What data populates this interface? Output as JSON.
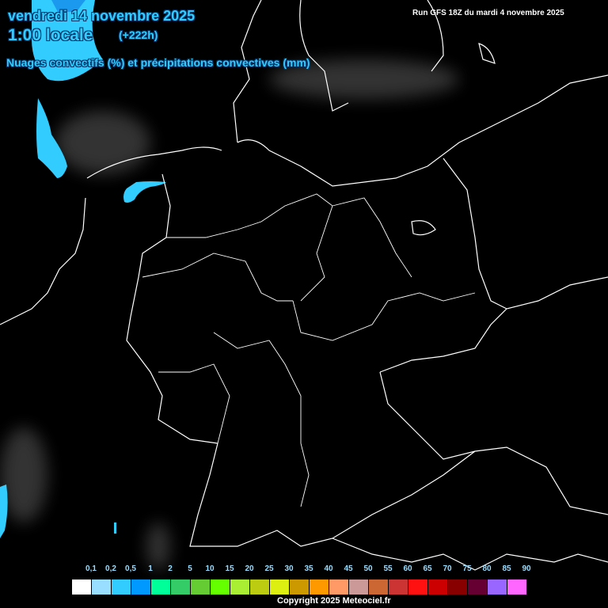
{
  "header": {
    "date": "vendredi 14 novembre 2025",
    "time": "1:00 locale",
    "offset": "(+222h)",
    "subtitle": "Nuages convectifs (%) et précipitations convectives (mm)",
    "run": "Run GFS 18Z du mardi 4 novembre 2025"
  },
  "legend": {
    "labels": [
      "0,1",
      "0,2",
      "0,5",
      "1",
      "2",
      "5",
      "10",
      "15",
      "20",
      "25",
      "30",
      "35",
      "40",
      "45",
      "50",
      "55",
      "60",
      "65",
      "70",
      "75",
      "80",
      "85",
      "90"
    ],
    "colors": [
      "#ffffff",
      "#99ddff",
      "#33ccff",
      "#0099ff",
      "#00ff99",
      "#33cc66",
      "#66cc33",
      "#66ff00",
      "#aaee33",
      "#bbcc11",
      "#ddee11",
      "#cc9900",
      "#ff9900",
      "#ff9966",
      "#cc9999",
      "#cc6633",
      "#cc3333",
      "#ff1111",
      "#cc0000",
      "#880000",
      "#660033",
      "#9966ff",
      "#ff66ff"
    ]
  },
  "footer": {
    "copyright": "Copyright 2025 Meteociel.fr"
  },
  "colors": {
    "precip": "#33ccff",
    "border": "#ffffff",
    "background": "#000000"
  }
}
